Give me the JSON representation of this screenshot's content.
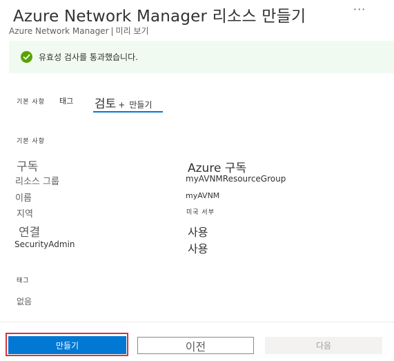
{
  "header": {
    "title": "Azure Network Manager 리소스 만들기",
    "more": "···",
    "subtitle_name": "Azure Network Manager",
    "subtitle_sep": "|",
    "subtitle_preview": "미리 보기"
  },
  "validation": {
    "message": "유효성 검사를 통과했습니다.",
    "status_color": "#57a300"
  },
  "tabs": [
    {
      "label": "기본 사항"
    },
    {
      "label": "태그"
    },
    {
      "label": "검토",
      "plus": "+",
      "label_suffix": "만들기",
      "active": true
    }
  ],
  "basics": {
    "heading": "기본 사항",
    "rows": [
      {
        "label": "구독",
        "value": "Azure 구독"
      },
      {
        "label": "리소스 그룹",
        "value": "myAVNMResourceGroup"
      },
      {
        "label": "이름",
        "value": "myAVNM"
      },
      {
        "label": "지역",
        "value": "미국 서부"
      },
      {
        "label": "연결",
        "value": "사용"
      },
      {
        "label": "SecurityAdmin",
        "value": "사용"
      }
    ]
  },
  "tags": {
    "heading": "태그",
    "value": "없음"
  },
  "footer": {
    "create_label": "만들기",
    "previous_label": "이전",
    "next_label": "다음",
    "accent": "#0078d4",
    "highlight_color": "#d13438"
  }
}
